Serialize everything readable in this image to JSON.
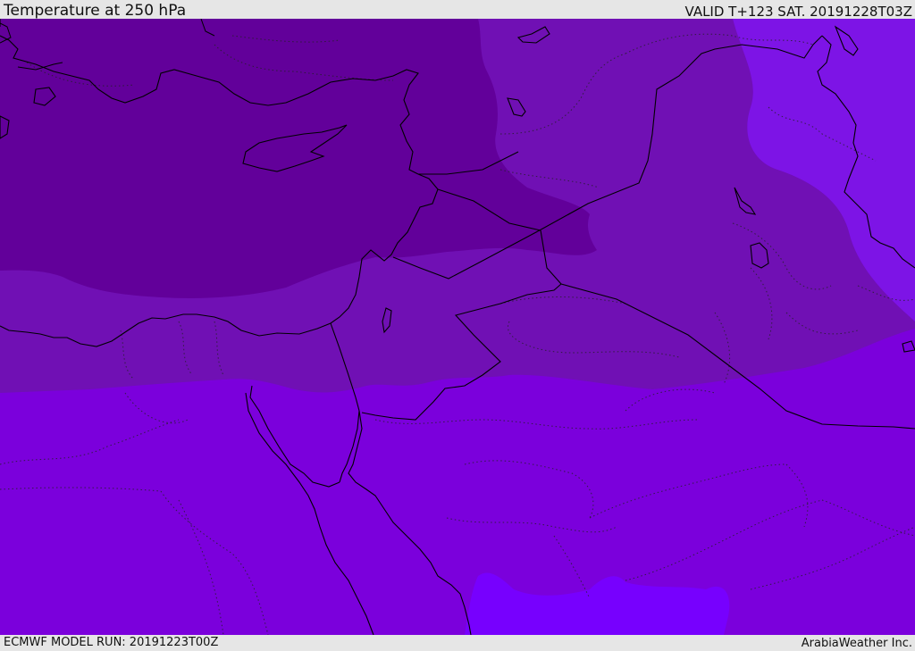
{
  "header": {
    "title": "Temperature at 250 hPa",
    "valid": "VALID T+123 SAT. 20191228T03Z"
  },
  "footer": {
    "model_run": "ECMWF MODEL RUN: 20191223T00Z",
    "credit": "ArabiaWeather Inc."
  },
  "map": {
    "variable": "Temperature at 250 hPa",
    "colors": {
      "coldest": "#62009a",
      "cold": "#7010b4",
      "mid": "#7b00dc",
      "warm": "#7d14e6",
      "warmest": "#7700fe",
      "border": "#000000"
    }
  }
}
